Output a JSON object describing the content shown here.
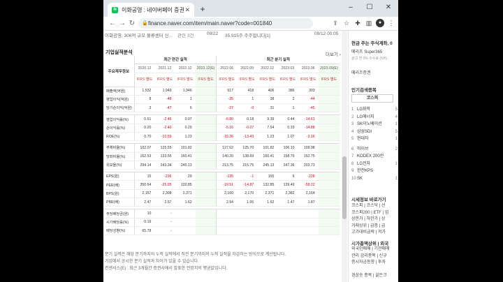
{
  "browser": {
    "tab_title": "이화공영 : 네이버페이 증권",
    "url": "finance.naver.com/item/main.naver?code=001840",
    "minimize": "–",
    "maximize": "☐",
    "close": "✕",
    "new_tab": "+",
    "tab_close": "✕"
  },
  "news": {
    "headline": "이화공영, 306억 규모 물류센터 신...",
    "label": "관련 3건",
    "date1": "09/22",
    "item2": "35,915주 주주합니다[1]",
    "date2": "09/12 00:05"
  },
  "section": {
    "title": "기업실적분석",
    "more": "더보기 ›"
  },
  "table": {
    "row_header": "주요재무정보",
    "annual_header": "최근 연간 실적",
    "quarter_header": "최근 분기 실적",
    "periods": [
      "2020.12",
      "2021.12",
      "2022.12",
      "2023.12(E)",
      "2022.06",
      "2022.09",
      "2022.12",
      "2023.03",
      "2023.06",
      "2023.09(E)"
    ],
    "ifrs": "IFRS 별도",
    "rows": [
      {
        "label": "매출액(억원)",
        "v": [
          "1,532",
          "1,949",
          "1,946",
          "",
          "517",
          "418",
          "406",
          "386",
          "303",
          ""
        ]
      },
      {
        "label": "영업이익(억원)",
        "v": [
          "8",
          "-48",
          "1",
          "",
          "-35",
          "1",
          "38",
          "2",
          "-44",
          ""
        ]
      },
      {
        "label": "당기순이익(억원)",
        "v": [
          "3",
          "-47",
          "6",
          "",
          "-27",
          "-0",
          "31",
          "1",
          "-45",
          ""
        ]
      },
      {
        "label": "영업이익률(%)",
        "v": [
          "0.51",
          "-2.46",
          "0.07",
          "",
          "-6.80",
          "0.18",
          "9.39",
          "0.44",
          "-14.61",
          ""
        ]
      },
      {
        "label": "순이익률(%)",
        "v": [
          "0.20",
          "-2.40",
          "0.29",
          "",
          "-5.16",
          "-0.07",
          "7.54",
          "0.33",
          "-14.88",
          ""
        ]
      },
      {
        "label": "ROE(%)",
        "v": [
          "0.70",
          "-10.59",
          "1.23",
          "",
          "-15.26",
          "-13.43",
          "1.23",
          "1.07",
          "-3.16",
          ""
        ]
      },
      {
        "label": "부채비율(%)",
        "v": [
          "102.07",
          "125.55",
          "101.82",
          "",
          "127.62",
          "125.70",
          "101.82",
          "106.10",
          "109.98",
          ""
        ]
      },
      {
        "label": "당좌비율(%)",
        "v": [
          "162.53",
          "133.55",
          "160.41",
          "",
          "140.20",
          "138.69",
          "160.41",
          "158.76",
          "152.75",
          ""
        ]
      },
      {
        "label": "유보율(%)",
        "v": [
          "294.14",
          "243.34",
          "245.13",
          "",
          "213.75",
          "215.75",
          "245.13",
          "247.36",
          "203.73",
          ""
        ]
      },
      {
        "label": "EPS(원)",
        "v": [
          "15",
          "-236",
          "29",
          "",
          "-135",
          "-1",
          "155",
          "6",
          "-228",
          ""
        ]
      },
      {
        "label": "PER(배)",
        "v": [
          "350.64",
          "-25.05",
          "132.85",
          "",
          "-19.51",
          "-14.87",
          "132.85",
          "139.49",
          "-59.22",
          ""
        ]
      },
      {
        "label": "BPS(원)",
        "v": [
          "2,157",
          "2,308",
          "2,371",
          "",
          "2,160",
          "2,170",
          "2,371",
          "2,382",
          "2,164",
          ""
        ]
      },
      {
        "label": "PBR(배)",
        "v": [
          "2.47",
          "2.57",
          "1.62",
          "",
          "2.94",
          "1.95",
          "1.62",
          "1.47",
          "1.87",
          ""
        ]
      },
      {
        "label": "주당배당금(원)",
        "v": [
          "10",
          "-",
          "",
          "",
          "",
          "",
          "",
          "",
          "",
          ""
        ]
      },
      {
        "label": "시가배당률(%)",
        "v": [
          "0.19",
          "-",
          "",
          "",
          "",
          "",
          "",
          "",
          "",
          ""
        ]
      },
      {
        "label": "배당성향(%)",
        "v": [
          "65.78",
          "-",
          "",
          "",
          "",
          "",
          "",
          "",
          "",
          ""
        ]
      }
    ]
  },
  "notes": [
    "분기 실적은 해당 분기까지의 누적 실적에서 직전 분기까지의 누적 실적을 차감하는 방식으로 계산됩니다.",
    "기업에서 공시한 분기 실적과 차이가 있을 수 있습니다.",
    "컨센서스(E) : 최근 3개월간 증권사에서 발표한 전망치의 평균값입니다."
  ],
  "side": {
    "ad1": "현금 주는 주식계좌, 0",
    "ad2": "메리츠 Super365",
    "ad3": "광고 연 0% 수수료 (NH)",
    "ad4": "메리츠증권",
    "hot_title": "인기검색종목",
    "hot_tab": "코스피",
    "hot": [
      {
        "n": "1",
        "name": "LG화학",
        "c": "5"
      },
      {
        "n": "2",
        "name": "LG에너지",
        "c": "4"
      },
      {
        "n": "3",
        "name": "SK이노베이션",
        "c": "1"
      },
      {
        "n": "4",
        "name": "삼성SDI",
        "c": "5"
      },
      {
        "n": "5",
        "name": "현대차",
        "c": "1"
      },
      {
        "n": "6",
        "name": "하이브",
        "c": "2"
      },
      {
        "n": "7",
        "name": "KODEX 200선",
        "c": ""
      },
      {
        "n": "8",
        "name": "LG전자",
        "c": "1"
      },
      {
        "n": "9",
        "name": "한전KPS",
        "c": ""
      },
      {
        "n": "10",
        "name": "SK",
        "c": "1"
      }
    ],
    "market_title": "시세정보 바로가기",
    "market_links": [
      "코스피 | 코스닥 | 선",
      "코스피200 | ETF | 업",
      "상한가 | 하한가 | 상",
      "거래상위 | 급증 | 급",
      "고가대비급락 | 저가"
    ],
    "rank_title": "시가총액상위 | 외국",
    "rank_links": [
      "외국인매매 | 기관매매",
      "관리 감리종목 | 신규",
      "증시자금동향 | 투자",
      "",
      "경상승 종목 | 골든크"
    ]
  }
}
